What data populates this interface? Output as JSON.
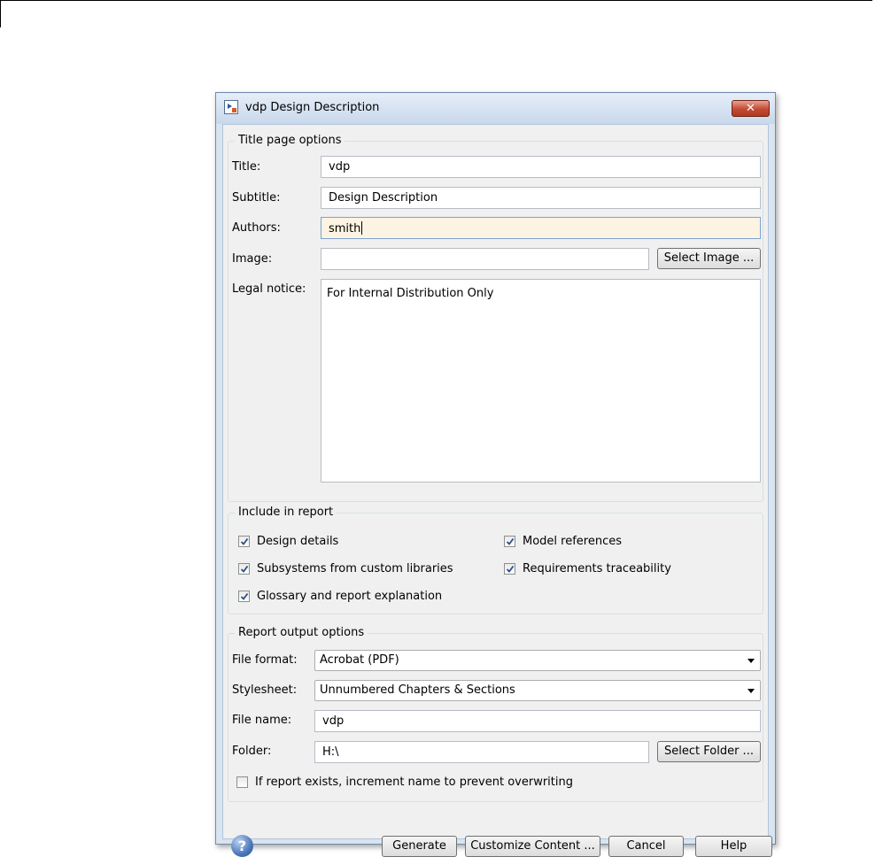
{
  "window": {
    "title": "vdp Design Description",
    "close_glyph": "✕"
  },
  "title_page": {
    "group_title": "Title page options",
    "title_label": "Title:",
    "title_value": "vdp",
    "subtitle_label": "Subtitle:",
    "subtitle_value": "Design Description",
    "authors_label": "Authors:",
    "authors_value": "smith",
    "image_label": "Image:",
    "image_value": "",
    "select_image_label": "Select Image ...",
    "legal_label": "Legal notice:",
    "legal_value": "For Internal Distribution Only"
  },
  "include": {
    "group_title": "Include in report",
    "items": [
      {
        "label": "Design details",
        "checked": true
      },
      {
        "label": "Model references",
        "checked": true
      },
      {
        "label": "Subsystems from custom libraries",
        "checked": true
      },
      {
        "label": "Requirements traceability",
        "checked": true
      },
      {
        "label": "Glossary and report explanation",
        "checked": true
      }
    ]
  },
  "output": {
    "group_title": "Report output options",
    "file_format_label": "File format:",
    "file_format_value": "Acrobat (PDF)",
    "stylesheet_label": "Stylesheet:",
    "stylesheet_value": "Unnumbered Chapters & Sections",
    "file_name_label": "File name:",
    "file_name_value": "vdp",
    "folder_label": "Folder:",
    "folder_value": "H:\\",
    "select_folder_label": "Select Folder ...",
    "increment_label": "If report exists, increment name to prevent overwriting",
    "increment_checked": false
  },
  "footer": {
    "help_glyph": "?",
    "generate_label": "Generate",
    "customize_label": "Customize Content ...",
    "cancel_label": "Cancel",
    "help_label": "Help"
  },
  "colors": {
    "titlebar": "#c8d8ec",
    "close_button": "#c24a34",
    "focused_field": "#fdf3e3",
    "client_bg": "#f0f0f0"
  }
}
